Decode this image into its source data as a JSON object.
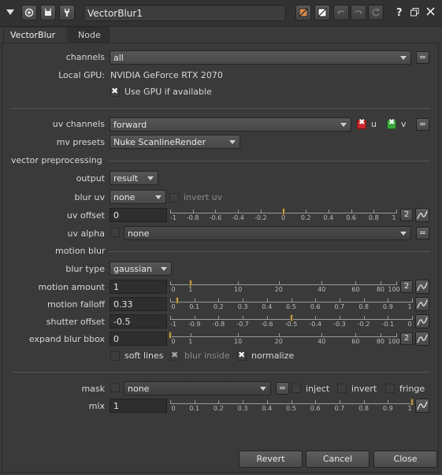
{
  "node": {
    "name": "VectorBlur1"
  },
  "tabs": [
    {
      "label": "VectorBlur"
    },
    {
      "label": "Node"
    }
  ],
  "fields": {
    "channels": {
      "label": "channels",
      "value": "all"
    },
    "local_gpu": {
      "label": "Local GPU:",
      "value": "NVIDIA GeForce RTX 2070"
    },
    "use_gpu": {
      "label": "Use GPU if available",
      "checked": true
    },
    "uv_channels": {
      "label": "uv channels",
      "value": "forward",
      "u_label": "u",
      "v_label": "v"
    },
    "mv_presets": {
      "label": "mv presets",
      "value": "Nuke ScanlineRender"
    },
    "output": {
      "label": "output",
      "value": "result"
    },
    "blur_uv": {
      "label": "blur uv",
      "value": "none",
      "invert_label": "invert uv"
    },
    "uv_offset": {
      "label": "uv offset",
      "value": "0",
      "side": "2",
      "ticks": [
        "-1",
        "-0.8",
        "-0.6",
        "-0.4",
        "-0.2",
        "0",
        "0.2",
        "0.4",
        "0.6",
        "0.8",
        "1"
      ]
    },
    "uv_alpha": {
      "label": "uv alpha",
      "value": "none"
    },
    "blur_type": {
      "label": "blur type",
      "value": "gaussian"
    },
    "motion_amount": {
      "label": "motion amount",
      "value": "1",
      "side": "2",
      "ticks": [
        "0",
        "1",
        "10",
        "20",
        "40",
        "60",
        "80",
        "100"
      ]
    },
    "motion_falloff": {
      "label": "motion falloff",
      "value": "0.33",
      "ticks": [
        "0",
        "0.1",
        "0.2",
        "0.3",
        "0.4",
        "0.5",
        "0.6",
        "0.7",
        "0.8",
        "0.9",
        "1"
      ]
    },
    "shutter_offset": {
      "label": "shutter offset",
      "value": "-0.5",
      "ticks": [
        "-1",
        "-0.9",
        "-0.8",
        "-0.7",
        "-0.6",
        "-0.5",
        "-0.4",
        "-0.3",
        "-0.2",
        "-0.1",
        "0"
      ]
    },
    "expand_blur_bbox": {
      "label": "expand blur bbox",
      "value": "0",
      "side": "2",
      "ticks": [
        "0",
        "1",
        "10",
        "20",
        "40",
        "60",
        "80",
        "100"
      ]
    },
    "soft_lines": {
      "label": "soft lines",
      "checked": false
    },
    "blur_inside": {
      "label": "blur inside",
      "checked": true
    },
    "normalize": {
      "label": "normalize",
      "checked": true
    },
    "mask": {
      "label": "mask",
      "value": "none",
      "inject_label": "inject",
      "invert_label": "invert",
      "fringe_label": "fringe"
    },
    "mix": {
      "label": "mix",
      "value": "1",
      "ticks": [
        "0",
        "0.1",
        "0.2",
        "0.3",
        "0.4",
        "0.5",
        "0.6",
        "0.7",
        "0.8",
        "0.9",
        "1"
      ]
    }
  },
  "sections": {
    "vector_preprocessing": "vector preprocessing",
    "motion_blur": "motion blur"
  },
  "buttons": {
    "revert": "Revert",
    "cancel": "Cancel",
    "close": "Close",
    "eq": "="
  },
  "titlebar": {
    "help": "?"
  },
  "colors": {
    "handle": "#b89a52",
    "u_red": "#c8282a",
    "v_green": "#3aa63a"
  }
}
